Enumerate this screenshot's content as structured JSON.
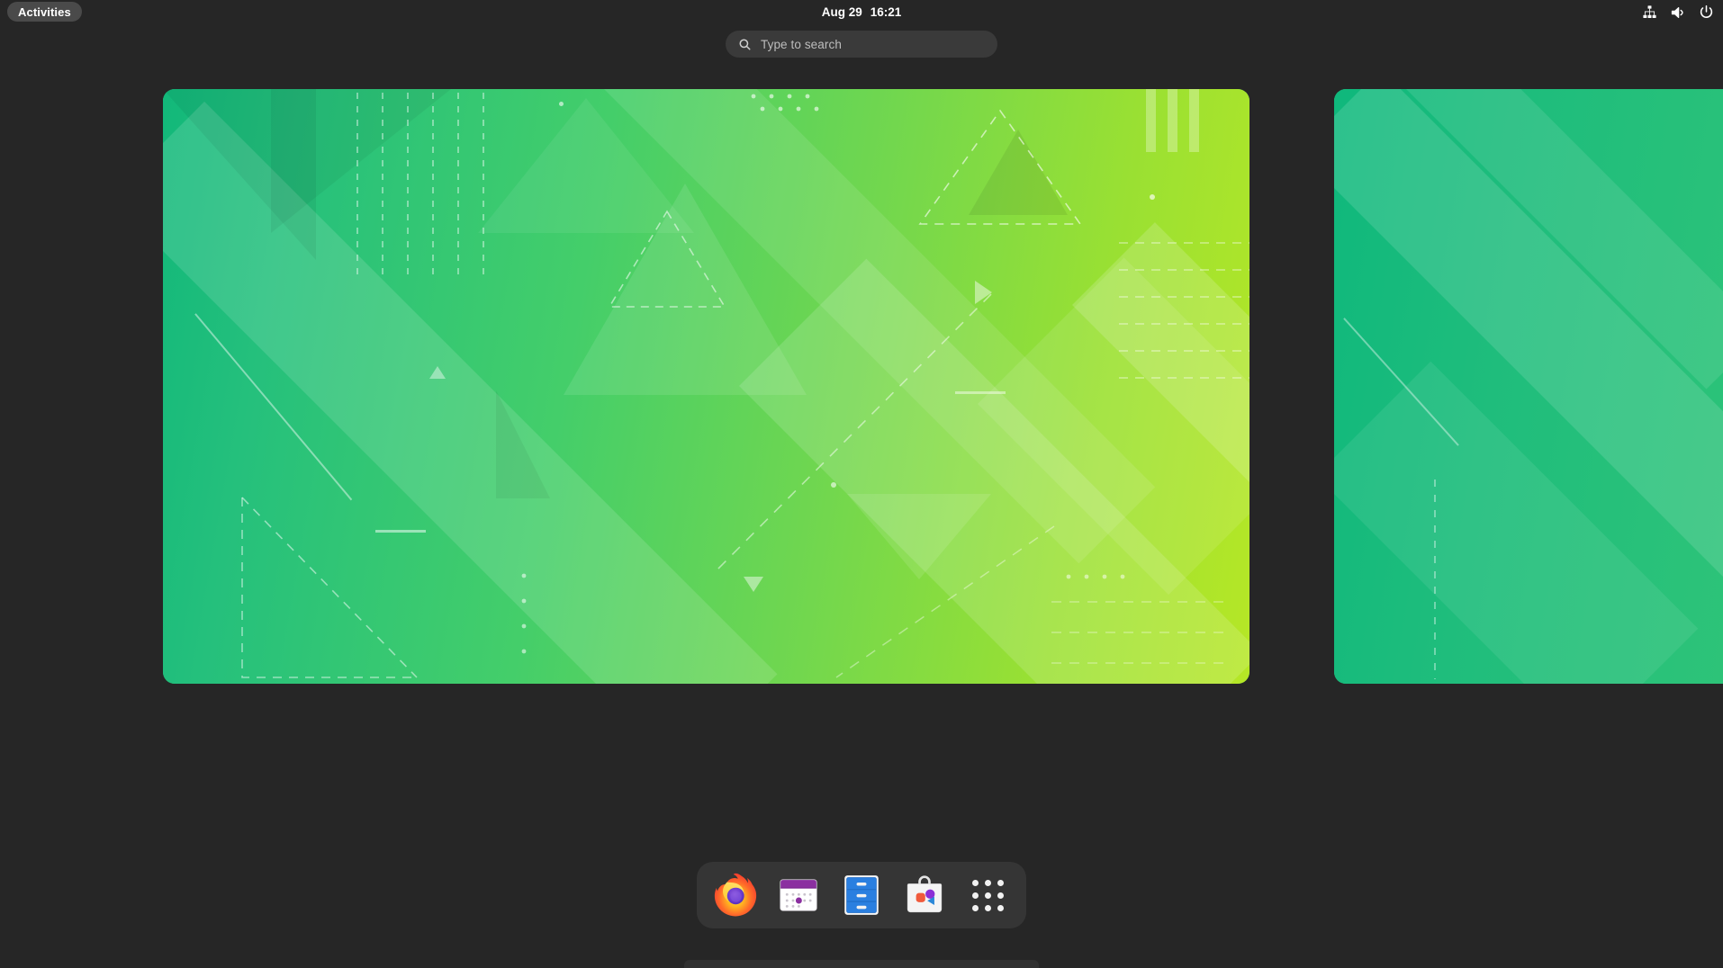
{
  "topbar": {
    "activities_label": "Activities",
    "clock": {
      "date": "Aug 29",
      "time": "16:21"
    },
    "system_icons": [
      {
        "name": "wired-network-icon",
        "label": "Wired Network"
      },
      {
        "name": "volume-icon",
        "label": "Volume"
      },
      {
        "name": "power-icon",
        "label": "Power"
      }
    ]
  },
  "search": {
    "placeholder": "Type to search",
    "value": "",
    "icon": "search-icon"
  },
  "overview": {
    "workspaces": [
      {
        "name": "workspace-1",
        "active": true,
        "wallpaper": "green-geometric"
      },
      {
        "name": "workspace-2",
        "active": false,
        "wallpaper": "green-geometric"
      }
    ]
  },
  "dock": {
    "items": [
      {
        "name": "firefox",
        "label": "Firefox",
        "icon": "firefox-icon"
      },
      {
        "name": "calendar",
        "label": "Calendar",
        "icon": "calendar-icon"
      },
      {
        "name": "files",
        "label": "Files",
        "icon": "files-icon"
      },
      {
        "name": "software",
        "label": "Software",
        "icon": "software-icon"
      },
      {
        "name": "show-apps",
        "label": "Show Applications",
        "icon": "app-grid-icon"
      }
    ]
  },
  "colors": {
    "shell_bg": "#262626",
    "topbar_bg": "#262626",
    "dock_bg": "#353535",
    "search_bg": "#3a3a3a",
    "activities_bg": "#4a4a4a",
    "text": "#ffffff",
    "placeholder": "#bdbdbd",
    "wallpaper_start": "#12b87a",
    "wallpaper_end": "#b6e726",
    "firefox_orange": "#ff6611",
    "firefox_purple": "#7542c8",
    "calendar_purple": "#8b2fa0",
    "files_blue": "#2a7fe0",
    "software_white": "#f4f4f4"
  }
}
